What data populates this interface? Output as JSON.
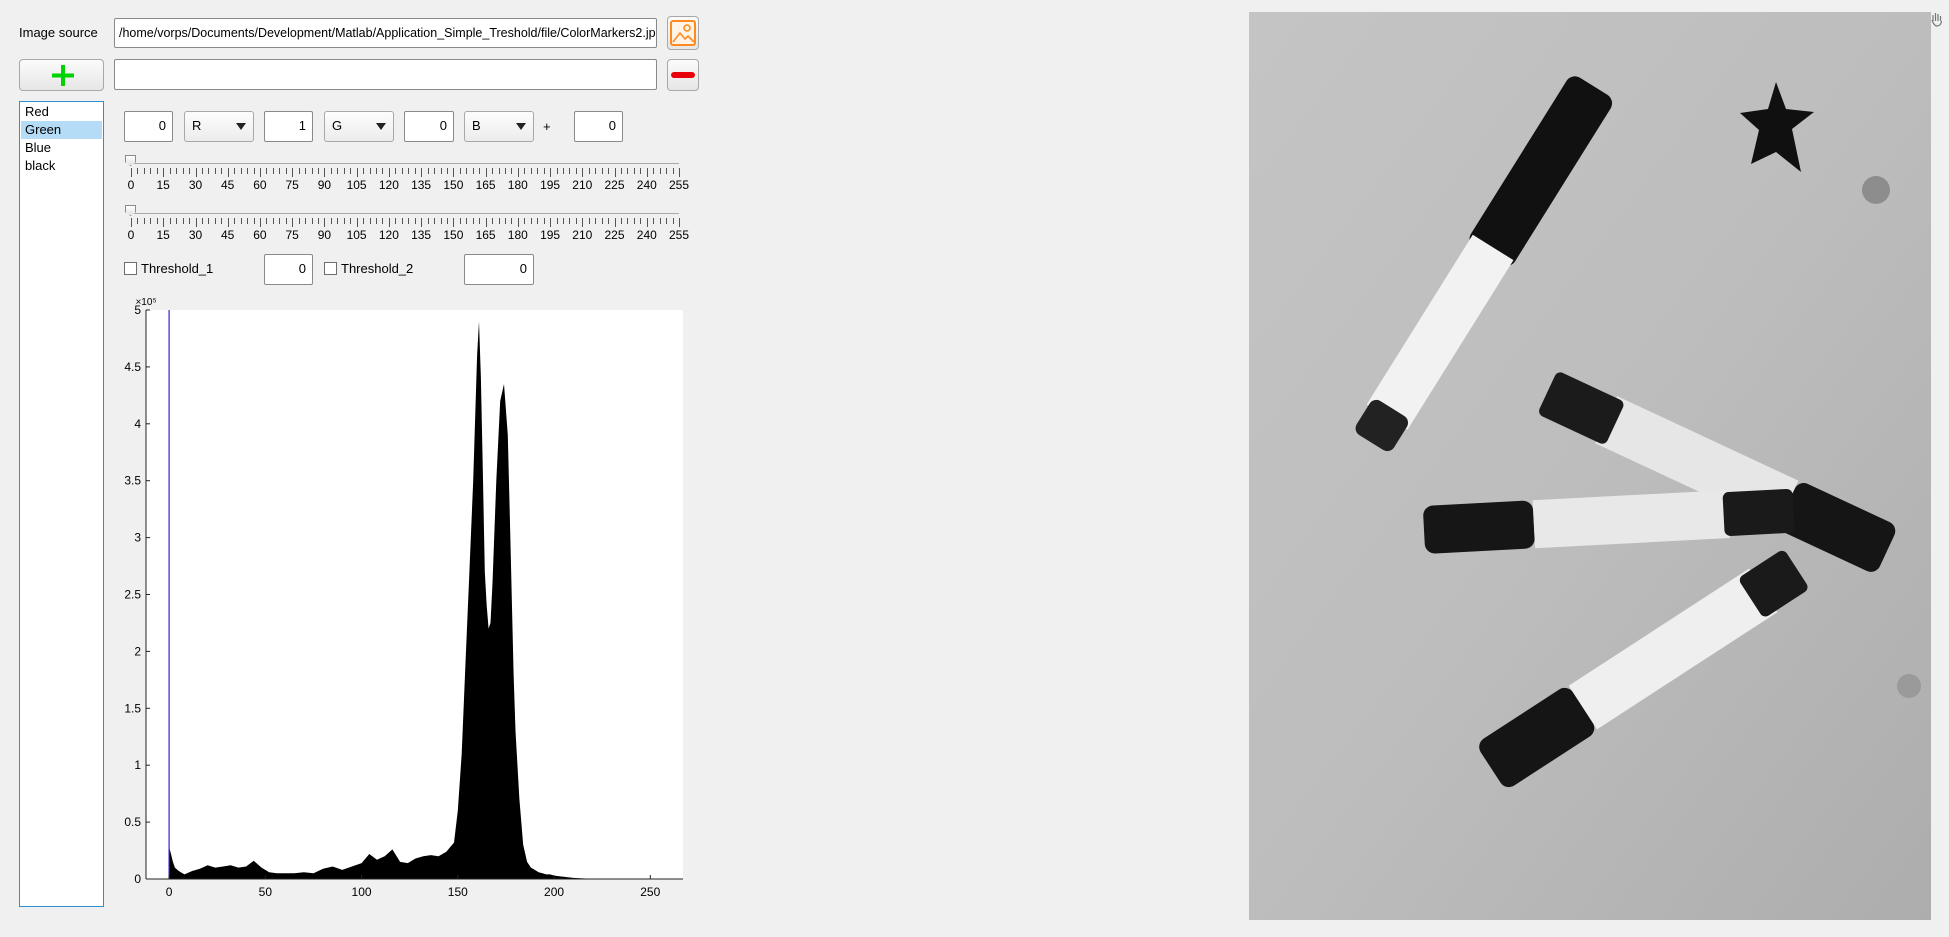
{
  "image_source": {
    "label": "Image source",
    "path": "/home/vorps/Documents/Development/Matlab/Application_Simple_Treshold/file/ColorMarkers2.jpg"
  },
  "name_field": {
    "value": ""
  },
  "markers": {
    "items": [
      "Red",
      "Green",
      "Blue",
      "black"
    ],
    "selected": "Green"
  },
  "formula": {
    "coef_r": "0",
    "channel_1": "R",
    "coef_g": "1",
    "channel_2": "G",
    "coef_b": "0",
    "channel_3": "B",
    "plus_label": "+",
    "offset": "0"
  },
  "sliders": {
    "min": 0,
    "max": 255,
    "ticks": [
      "0",
      "15",
      "30",
      "45",
      "60",
      "75",
      "90",
      "105",
      "120",
      "135",
      "150",
      "165",
      "180",
      "195",
      "210",
      "225",
      "240",
      "255"
    ],
    "slider_1_value": 0,
    "slider_2_value": 0
  },
  "thresholds": {
    "threshold_1_label": "Threshold_1",
    "threshold_1_checked": false,
    "threshold_1_value": "0",
    "threshold_2_label": "Threshold_2",
    "threshold_2_checked": false,
    "threshold_2_value": "0"
  },
  "colors": {
    "add": "#00d400",
    "remove": "#e8000b",
    "list_border": "#2f8fd3",
    "list_selected": "#b4dcf6",
    "threshold_line": "#3a1bd8"
  },
  "icons": {
    "browse": "image-icon",
    "add": "plus-icon",
    "remove": "minus-icon",
    "toolbar": [
      "export-icon",
      "pan-icon"
    ]
  },
  "chart_data": {
    "type": "area",
    "title": "",
    "xlabel": "",
    "ylabel": "",
    "exponent_label": "×10⁵",
    "xlim": [
      -12,
      267
    ],
    "ylim": [
      0,
      5
    ],
    "x_ticks": [
      "0",
      "50",
      "100",
      "150",
      "200",
      "250"
    ],
    "y_ticks": [
      "0",
      "0.5",
      "1",
      "1.5",
      "2",
      "2.5",
      "3",
      "3.5",
      "4",
      "4.5",
      "5"
    ],
    "threshold_x": 0,
    "series": [
      {
        "x": [
          0,
          1,
          2,
          3,
          5,
          8,
          12,
          16,
          20,
          24,
          28,
          32,
          36,
          40,
          44,
          48,
          52,
          56,
          60,
          65,
          70,
          75,
          80,
          85,
          90,
          95,
          100,
          104,
          108,
          112,
          116,
          120,
          124,
          128,
          132,
          136,
          140,
          144,
          148,
          150,
          152,
          154,
          156,
          158,
          160,
          161,
          162,
          163,
          164,
          165,
          166,
          167,
          168,
          170,
          172,
          174,
          176,
          177,
          178,
          179,
          180,
          182,
          184,
          186,
          188,
          190,
          192,
          194,
          196,
          198,
          200,
          205,
          210,
          215,
          220,
          225,
          230,
          240,
          255
        ],
        "y": [
          0.28,
          0.22,
          0.15,
          0.1,
          0.07,
          0.04,
          0.07,
          0.09,
          0.12,
          0.1,
          0.11,
          0.12,
          0.1,
          0.11,
          0.16,
          0.1,
          0.06,
          0.05,
          0.05,
          0.05,
          0.06,
          0.05,
          0.09,
          0.11,
          0.08,
          0.11,
          0.14,
          0.22,
          0.17,
          0.2,
          0.26,
          0.15,
          0.14,
          0.18,
          0.2,
          0.21,
          0.2,
          0.24,
          0.32,
          0.6,
          1.1,
          1.9,
          2.7,
          3.5,
          4.6,
          4.9,
          4.4,
          3.6,
          2.7,
          2.4,
          2.2,
          2.25,
          2.6,
          3.5,
          4.2,
          4.35,
          3.9,
          3.2,
          2.5,
          1.8,
          1.3,
          0.7,
          0.3,
          0.15,
          0.1,
          0.08,
          0.06,
          0.05,
          0.04,
          0.04,
          0.03,
          0.02,
          0.01,
          0.005,
          0.003,
          0.002,
          0.001,
          0,
          0
        ]
      }
    ]
  }
}
